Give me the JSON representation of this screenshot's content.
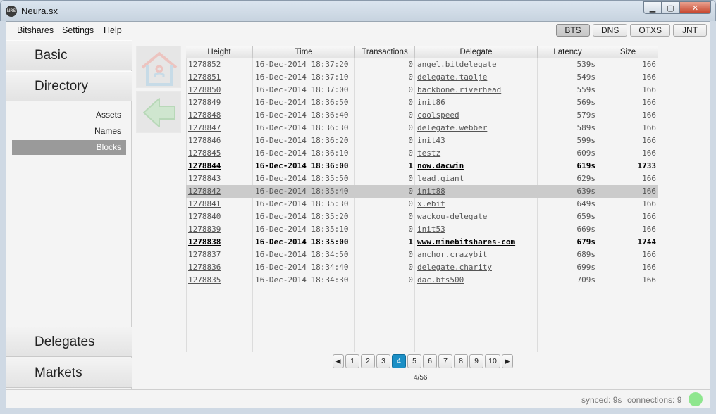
{
  "window": {
    "title": "Neura.sx",
    "icon_label": "NRS"
  },
  "menu": [
    "Bitshares",
    "Settings",
    "Help"
  ],
  "currencies": [
    {
      "label": "BTS",
      "active": true
    },
    {
      "label": "DNS",
      "active": false
    },
    {
      "label": "OTXS",
      "active": false
    },
    {
      "label": "JNT",
      "active": false
    }
  ],
  "sidebar": {
    "basic": "Basic",
    "directory": "Directory",
    "sub_items": [
      "Assets",
      "Names",
      "Blocks"
    ],
    "active_sub": "Blocks",
    "delegates": "Delegates",
    "markets": "Markets"
  },
  "icons": {
    "home": "home-icon",
    "back": "back-arrow-icon"
  },
  "table": {
    "columns": [
      "Height",
      "Time",
      "Transactions",
      "Delegate",
      "Latency",
      "Size"
    ],
    "rows": [
      [
        "1278852",
        "16-Dec-2014 18:37:20",
        "0",
        "angel.bitdelegate",
        "539s",
        "166"
      ],
      [
        "1278851",
        "16-Dec-2014 18:37:10",
        "0",
        "delegate.taolje",
        "549s",
        "166"
      ],
      [
        "1278850",
        "16-Dec-2014 18:37:00",
        "0",
        "backbone.riverhead",
        "559s",
        "166"
      ],
      [
        "1278849",
        "16-Dec-2014 18:36:50",
        "0",
        "init86",
        "569s",
        "166"
      ],
      [
        "1278848",
        "16-Dec-2014 18:36:40",
        "0",
        "coolspeed",
        "579s",
        "166"
      ],
      [
        "1278847",
        "16-Dec-2014 18:36:30",
        "0",
        "delegate.webber",
        "589s",
        "166"
      ],
      [
        "1278846",
        "16-Dec-2014 18:36:20",
        "0",
        "init43",
        "599s",
        "166"
      ],
      [
        "1278845",
        "16-Dec-2014 18:36:10",
        "0",
        "testz",
        "609s",
        "166"
      ],
      [
        "1278844",
        "16-Dec-2014 18:36:00",
        "1",
        "now.dacwin",
        "619s",
        "1733"
      ],
      [
        "1278843",
        "16-Dec-2014 18:35:50",
        "0",
        "lead.giant",
        "629s",
        "166"
      ],
      [
        "1278842",
        "16-Dec-2014 18:35:40",
        "0",
        "init88",
        "639s",
        "166"
      ],
      [
        "1278841",
        "16-Dec-2014 18:35:30",
        "0",
        "x.ebit",
        "649s",
        "166"
      ],
      [
        "1278840",
        "16-Dec-2014 18:35:20",
        "0",
        "wackou-delegate",
        "659s",
        "166"
      ],
      [
        "1278839",
        "16-Dec-2014 18:35:10",
        "0",
        "init53",
        "669s",
        "166"
      ],
      [
        "1278838",
        "16-Dec-2014 18:35:00",
        "1",
        "www.minebitshares-com",
        "679s",
        "1744"
      ],
      [
        "1278837",
        "16-Dec-2014 18:34:50",
        "0",
        "anchor.crazybit",
        "689s",
        "166"
      ],
      [
        "1278836",
        "16-Dec-2014 18:34:40",
        "0",
        "delegate.charity",
        "699s",
        "166"
      ],
      [
        "1278835",
        "16-Dec-2014 18:34:30",
        "0",
        "dac.bts500",
        "709s",
        "166"
      ]
    ],
    "selected_height": "1278842"
  },
  "pagination": {
    "pages": [
      "1",
      "2",
      "3",
      "4",
      "5",
      "6",
      "7",
      "8",
      "9",
      "10"
    ],
    "current": "4",
    "prev_icon": "◀",
    "next_icon": "▶",
    "counter": "4/56"
  },
  "status": {
    "synced": "synced: 9s",
    "connections": "connections: 9",
    "indicator_color": "#8ee68e"
  }
}
